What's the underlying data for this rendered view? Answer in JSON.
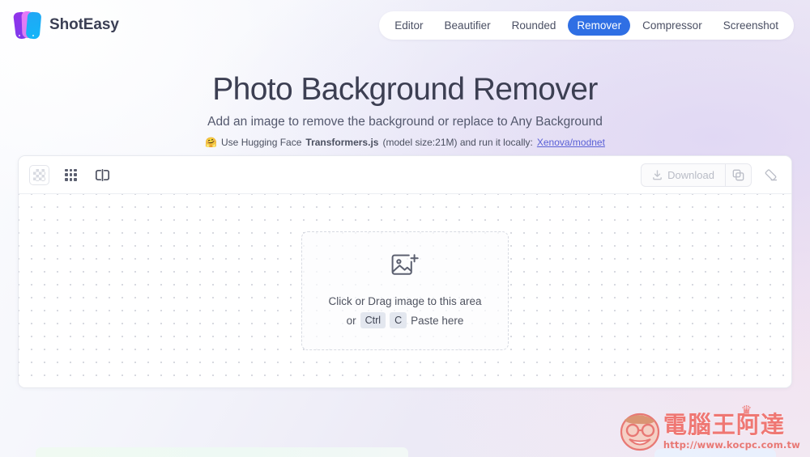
{
  "brand": {
    "name": "ShotEasy",
    "logo_icon": "shoteasy-logo-icon",
    "colors": {
      "purple": "#9333ea",
      "pink": "#e879f9",
      "blue": "#22a7f5"
    }
  },
  "nav": {
    "items": [
      {
        "label": "Editor",
        "active": false
      },
      {
        "label": "Beautifier",
        "active": false
      },
      {
        "label": "Rounded",
        "active": false
      },
      {
        "label": "Remover",
        "active": true
      },
      {
        "label": "Compressor",
        "active": false
      },
      {
        "label": "Screenshot",
        "active": false
      }
    ],
    "active_color": "#2f6fe4"
  },
  "hero": {
    "title": "Photo Background Remover",
    "subtitle": "Add an image to remove the background or replace to Any Background",
    "note": {
      "emoji": "🤗",
      "prefix": "Use Hugging Face ",
      "bold": "Transformers.js",
      "middle": " (model size:21M) and run it locally: ",
      "link": "Xenova/modnet"
    }
  },
  "toolbar": {
    "left_tools": [
      {
        "name": "transparency-checker",
        "icon": "checkerboard-icon",
        "active": true
      },
      {
        "name": "dot-grid",
        "icon": "grid-dots-icon",
        "active": false
      },
      {
        "name": "compare-split",
        "icon": "compare-split-icon",
        "active": false
      }
    ],
    "download_label": "Download",
    "download_icon": "download-icon",
    "download_disabled": true,
    "copy_icon": "copy-icon",
    "eraser_icon": "eraser-icon"
  },
  "dropzone": {
    "icon": "image-add-icon",
    "line1": "Click or Drag image to this area",
    "or": "or",
    "key1": "Ctrl",
    "key2": "C",
    "paste": "Paste here"
  },
  "watermark": {
    "title": "電腦王阿達",
    "url": "http://www.kocpc.com.tw",
    "crown": "♛",
    "color": "#ef6f6a"
  }
}
